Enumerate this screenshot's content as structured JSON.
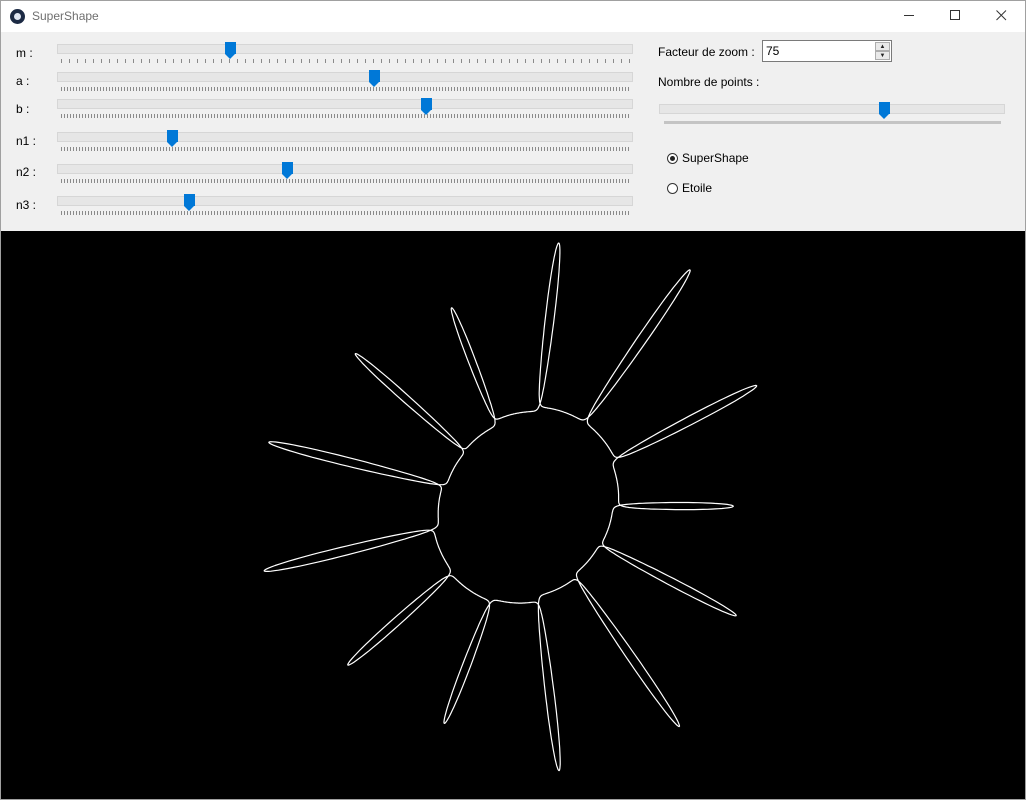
{
  "window": {
    "title": "SuperShape"
  },
  "sliders": [
    {
      "label": "m :",
      "value": 0.3
    },
    {
      "label": "a :",
      "value": 0.55
    },
    {
      "label": "b :",
      "value": 0.64
    },
    {
      "label": "n1 :",
      "value": 0.2
    },
    {
      "label": "n2 :",
      "value": 0.4
    },
    {
      "label": "n3 :",
      "value": 0.23
    }
  ],
  "zoom": {
    "label": "Facteur de zoom :",
    "value": "75"
  },
  "points": {
    "label": "Nombre de points :",
    "value": 0.65
  },
  "modes": [
    {
      "label": "SuperShape",
      "checked": true
    },
    {
      "label": "Etoile",
      "checked": false
    }
  ],
  "colors": {
    "accent": "#0078d7",
    "canvas_bg": "#000000",
    "shape_stroke": "#ffffff"
  }
}
